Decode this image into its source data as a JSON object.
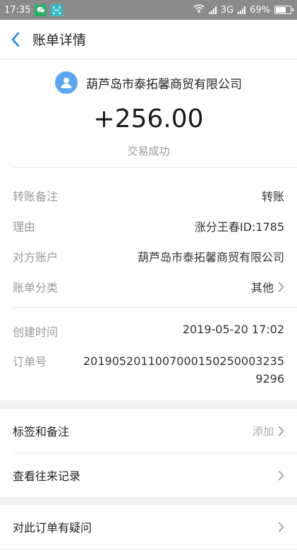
{
  "status_bar": {
    "time": "17:35",
    "network": "3G",
    "battery": "69%"
  },
  "header": {
    "title": "账单详情"
  },
  "summary": {
    "payee": "葫芦岛市泰拓馨商贸有限公司",
    "amount": "+256.00",
    "status": "交易成功"
  },
  "details": {
    "remark_label": "转账备注",
    "remark_value": "转账",
    "reason_label": "理由",
    "reason_value": "涨分王春ID:1785",
    "counterparty_label": "对方账户",
    "counterparty_value": "葫芦岛市泰拓馨商贸有限公司",
    "category_label": "账单分类",
    "category_value": "其他",
    "created_label": "创建时间",
    "created_value": "2019-05-20 17:02",
    "order_label": "订单号",
    "order_value": "2019052011007000150250003235 9296"
  },
  "actions": {
    "tags_label": "标签和备注",
    "tags_action": "添加",
    "history_label": "查看往来记录",
    "question_label": "对此订单有疑问"
  },
  "colors": {
    "accent": "#1e88e5",
    "avatar": "#5ca6f0",
    "statusbar": "#8b8b8b"
  }
}
